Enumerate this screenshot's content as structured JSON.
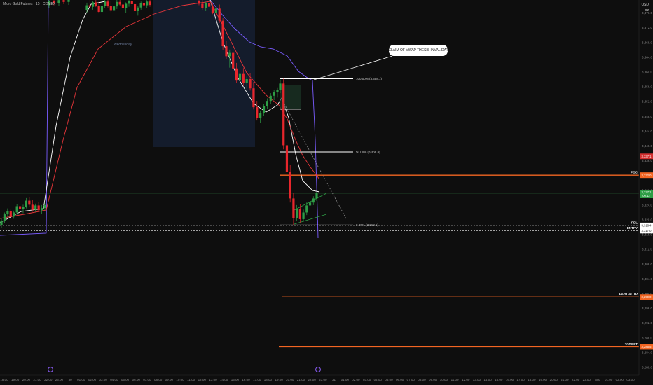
{
  "header": {
    "symbol_title": "Micro Gold Futures · 15 · COMEX",
    "currency": "USD",
    "unit": "oz"
  },
  "session_label": "Wednesday",
  "callout": {
    "text": "RECLAIM OF VWAP THESIS INVALIDATED"
  },
  "fib": [
    {
      "label": "100.00% (3,358.1)",
      "level": 100,
      "price": 3358.1
    },
    {
      "label": "50.00% (3,338.3)",
      "level": 50,
      "price": 3338.3
    },
    {
      "label": "0.00% (3,318.5)",
      "level": 0,
      "price": 3318.5
    }
  ],
  "price_lines": [
    {
      "name": "POC",
      "label": "POC",
      "price": 3332.0,
      "tag": "3,332.0",
      "color": "#f26522"
    },
    {
      "name": "PDL",
      "label": "PDL",
      "price": 3318.4,
      "tag": "3,318.4",
      "color": "#ffffff"
    },
    {
      "name": "ENTRY",
      "label": "ENTRY",
      "price": 3317.0,
      "tag": "3,317.0",
      "color": "#ffffff"
    },
    {
      "name": "PARTIAL TP",
      "label": "PARTIAL TP",
      "price": 3299.0,
      "tag": "3,299.0",
      "color": "#f26522"
    },
    {
      "name": "TARGET",
      "label": "TARGET",
      "price": 3285.5,
      "tag": "3,285.5",
      "color": "#f26522"
    }
  ],
  "chart_data": {
    "type": "candlestick",
    "title": "Micro Gold Futures · 15 · COMEX",
    "y_axis": {
      "ticks": [
        "3,376.0",
        "3,372.0",
        "3,368.0",
        "3,364.0",
        "3,360.0",
        "3,356.0",
        "3,352.0",
        "3,348.0",
        "3,344.0",
        "3,340.0",
        "3,336.0",
        "3,332.0",
        "3,328.0",
        "3,324.0",
        "3,320.0",
        "3,316.0",
        "3,312.0",
        "3,308.0",
        "3,304.0",
        "3,300.0",
        "3,296.0",
        "3,292.0",
        "3,288.0",
        "3,284.0",
        "3,280.0"
      ],
      "range": [
        3278.0,
        3380.0
      ]
    },
    "x_axis": {
      "ticks": [
        "18:00",
        "19:00",
        "20:00",
        "21:00",
        "22:00",
        "23:00",
        "30",
        "01:00",
        "02:00",
        "03:00",
        "04:00",
        "05:00",
        "06:00",
        "07:00",
        "08:00",
        "09:00",
        "10:00",
        "11:00",
        "12:00",
        "13:00",
        "14:00",
        "15:00",
        "16:00",
        "17:00",
        "18:00",
        "19:00",
        "20:00",
        "21:00",
        "22:00",
        "23:00",
        "31",
        "01:00",
        "02:00",
        "03:00",
        "04:00",
        "05:00",
        "06:00",
        "07:00",
        "08:00",
        "09:00",
        "10:00",
        "11:00",
        "12:00",
        "13:00",
        "14:00",
        "15:00",
        "16:00",
        "17:00",
        "18:00",
        "19:00",
        "20:00",
        "21:00",
        "22:00",
        "23:00",
        "Aug",
        "01:00",
        "02:00",
        "03:00"
      ]
    },
    "current_price": {
      "tag": "3,327.1",
      "sub": "00:12",
      "price": 3327.1
    },
    "red_tag": {
      "tag": "3,337.1",
      "price": 3337.1
    },
    "series": [
      {
        "name": "VWAP",
        "color": "#7a5cff"
      },
      {
        "name": "EMA fast",
        "color": "#ffffff"
      },
      {
        "name": "EMA slow",
        "color": "#e8363a"
      }
    ],
    "candles": [
      [
        3318.5,
        3320.4,
        3317.8,
        3319.7
      ],
      [
        3319.7,
        3321.9,
        3319.0,
        3321.4
      ],
      [
        3321.4,
        3323.0,
        3320.6,
        3322.2
      ],
      [
        3322.2,
        3322.9,
        3320.1,
        3320.8
      ],
      [
        3320.8,
        3322.4,
        3320.2,
        3321.9
      ],
      [
        3321.9,
        3324.1,
        3321.3,
        3323.6
      ],
      [
        3323.6,
        3325.2,
        3322.4,
        3322.8
      ],
      [
        3322.8,
        3324.0,
        3321.7,
        3323.4
      ],
      [
        3323.4,
        3325.8,
        3323.0,
        3325.1
      ],
      [
        3325.1,
        3326.0,
        3323.5,
        3324.0
      ],
      [
        3324.0,
        3325.2,
        3322.1,
        3322.6
      ],
      [
        3322.6,
        3324.3,
        3322.0,
        3323.8
      ],
      [
        3323.8,
        3324.7,
        3322.0,
        3322.5
      ],
      [
        3322.5,
        3323.9,
        3321.6,
        3323.1
      ],
      [
        3323.1,
        3324.4,
        3322.5,
        3323.9
      ],
      [
        3378.0,
        3380.0,
        3377.2,
        3379.1
      ],
      [
        3379.1,
        3380.0,
        3378.0,
        3378.6
      ],
      [
        3378.6,
        3379.8,
        3377.9,
        3379.4
      ],
      [
        3379.4,
        3380.0,
        3378.3,
        3378.9
      ],
      [
        3378.9,
        3379.9,
        3378.1,
        3379.6
      ],
      [
        3376.6,
        3378.7,
        3375.9,
        3378.0
      ],
      [
        3378.0,
        3379.8,
        3377.1,
        3377.6
      ],
      [
        3377.6,
        3379.2,
        3376.8,
        3378.8
      ],
      [
        3378.8,
        3379.9,
        3377.5,
        3377.9
      ],
      [
        3377.9,
        3378.9,
        3375.8,
        3376.2
      ],
      [
        3376.2,
        3378.4,
        3375.6,
        3377.9
      ],
      [
        3377.9,
        3379.6,
        3377.2,
        3379.0
      ],
      [
        3379.0,
        3379.9,
        3377.4,
        3377.8
      ],
      [
        3377.8,
        3379.1,
        3376.1,
        3376.5
      ],
      [
        3376.5,
        3378.3,
        3375.7,
        3377.7
      ],
      [
        3377.7,
        3379.5,
        3377.0,
        3378.9
      ],
      [
        3378.9,
        3379.9,
        3377.8,
        3378.2
      ],
      [
        3378.2,
        3379.4,
        3376.9,
        3377.3
      ],
      [
        3377.3,
        3378.8,
        3376.0,
        3378.4
      ],
      [
        3378.4,
        3379.7,
        3377.6,
        3379.1
      ],
      [
        3379.1,
        3379.9,
        3377.9,
        3378.3
      ],
      [
        3378.3,
        3379.3,
        3375.9,
        3376.4
      ],
      [
        3376.4,
        3377.8,
        3375.2,
        3377.4
      ],
      [
        3377.4,
        3379.0,
        3376.8,
        3378.6
      ],
      [
        3378.6,
        3379.8,
        3377.7,
        3378.0
      ],
      [
        3378.0,
        3379.4,
        3377.2,
        3379.0
      ],
      [
        3379.0,
        3379.9,
        3377.6,
        3378.1
      ],
      [
        3379.2,
        3380.0,
        3378.0,
        3378.4
      ],
      [
        3378.4,
        3379.6,
        3376.8,
        3377.2
      ],
      [
        3377.2,
        3379.0,
        3376.4,
        3378.5
      ],
      [
        3378.5,
        3379.8,
        3377.3,
        3377.6
      ],
      [
        3377.6,
        3378.4,
        3375.6,
        3376.0
      ],
      [
        3376.0,
        3377.5,
        3374.9,
        3377.1
      ],
      [
        3377.1,
        3378.2,
        3373.2,
        3373.8
      ],
      [
        3373.8,
        3374.6,
        3366.0,
        3366.9
      ],
      [
        3366.9,
        3368.3,
        3363.5,
        3364.2
      ],
      [
        3364.2,
        3366.0,
        3361.1,
        3365.1
      ],
      [
        3365.1,
        3366.1,
        3360.2,
        3360.9
      ],
      [
        3360.9,
        3362.4,
        3357.0,
        3357.6
      ],
      [
        3357.6,
        3360.1,
        3356.8,
        3359.4
      ],
      [
        3359.4,
        3361.0,
        3356.2,
        3356.9
      ],
      [
        3356.9,
        3358.7,
        3355.4,
        3358.0
      ],
      [
        3358.0,
        3359.6,
        3354.9,
        3355.5
      ],
      [
        3355.5,
        3357.2,
        3349.8,
        3350.4
      ],
      [
        3350.4,
        3352.1,
        3346.8,
        3347.4
      ],
      [
        3347.4,
        3349.5,
        3346.1,
        3348.9
      ],
      [
        3348.9,
        3351.3,
        3348.0,
        3350.7
      ],
      [
        3350.7,
        3352.8,
        3349.9,
        3352.1
      ],
      [
        3352.1,
        3354.2,
        3351.2,
        3353.5
      ],
      [
        3353.5,
        3355.0,
        3352.3,
        3354.4
      ],
      [
        3354.4,
        3355.6,
        3353.0,
        3355.1
      ],
      [
        3355.1,
        3357.9,
        3354.2,
        3356.8
      ],
      [
        3356.8,
        3358.1,
        3339.0,
        3340.1
      ],
      [
        3340.1,
        3342.0,
        3331.6,
        3332.9
      ],
      [
        3332.9,
        3334.8,
        3324.6,
        3325.7
      ],
      [
        3325.7,
        3327.2,
        3318.5,
        3320.4
      ],
      [
        3320.4,
        3323.9,
        3319.6,
        3322.8
      ],
      [
        3322.8,
        3324.1,
        3319.2,
        3320.1
      ],
      [
        3320.1,
        3322.7,
        3319.4,
        3321.9
      ],
      [
        3321.9,
        3324.6,
        3321.2,
        3323.8
      ],
      [
        3323.8,
        3325.4,
        3322.1,
        3324.6
      ],
      [
        3324.6,
        3326.3,
        3323.9,
        3325.7
      ],
      [
        3325.7,
        3327.5,
        3325.0,
        3327.1
      ]
    ]
  }
}
